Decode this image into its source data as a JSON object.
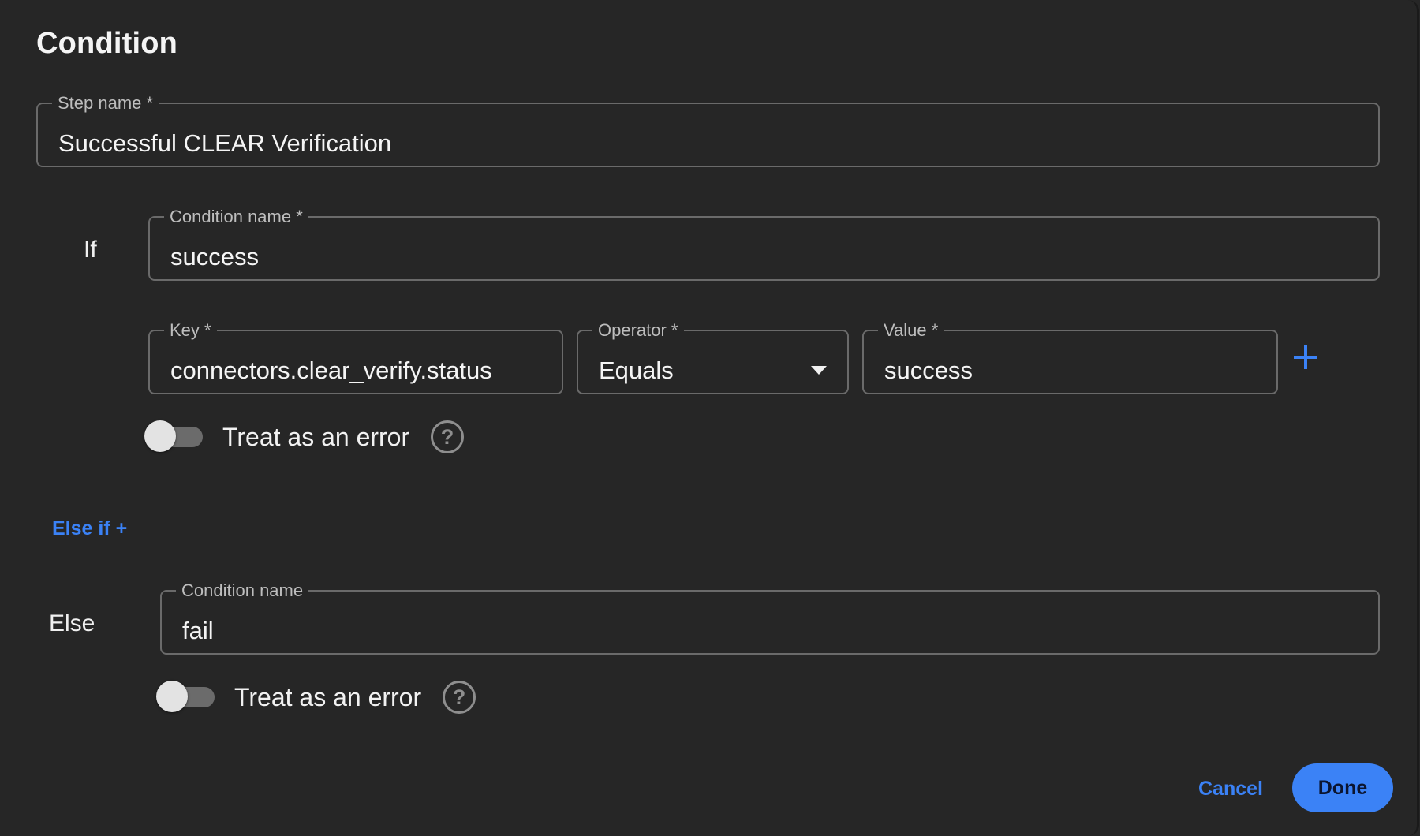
{
  "dialog": {
    "title": "Condition",
    "step_name": {
      "label": "Step name *",
      "value": "Successful CLEAR Verification"
    },
    "if_block": {
      "label": "If",
      "condition_name": {
        "label": "Condition name *",
        "value": "success"
      },
      "rules": [
        {
          "key": {
            "label": "Key *",
            "value": "connectors.clear_verify.status"
          },
          "operator": {
            "label": "Operator *",
            "value": "Equals"
          },
          "value": {
            "label": "Value *",
            "value": "success"
          }
        }
      ],
      "add_rule_icon": "plus-icon",
      "treat_as_error": {
        "label": "Treat as an error",
        "checked": false,
        "help_icon": "question-circle-icon"
      }
    },
    "else_if_link": "Else if +",
    "else_block": {
      "label": "Else",
      "condition_name": {
        "label": "Condition name",
        "value": "fail"
      },
      "treat_as_error": {
        "label": "Treat as an error",
        "checked": false,
        "help_icon": "question-circle-icon"
      }
    },
    "actions": {
      "cancel": "Cancel",
      "done": "Done"
    }
  },
  "colors": {
    "background": "#262626",
    "accent": "#3b82f6",
    "border": "#6a6a6a"
  }
}
